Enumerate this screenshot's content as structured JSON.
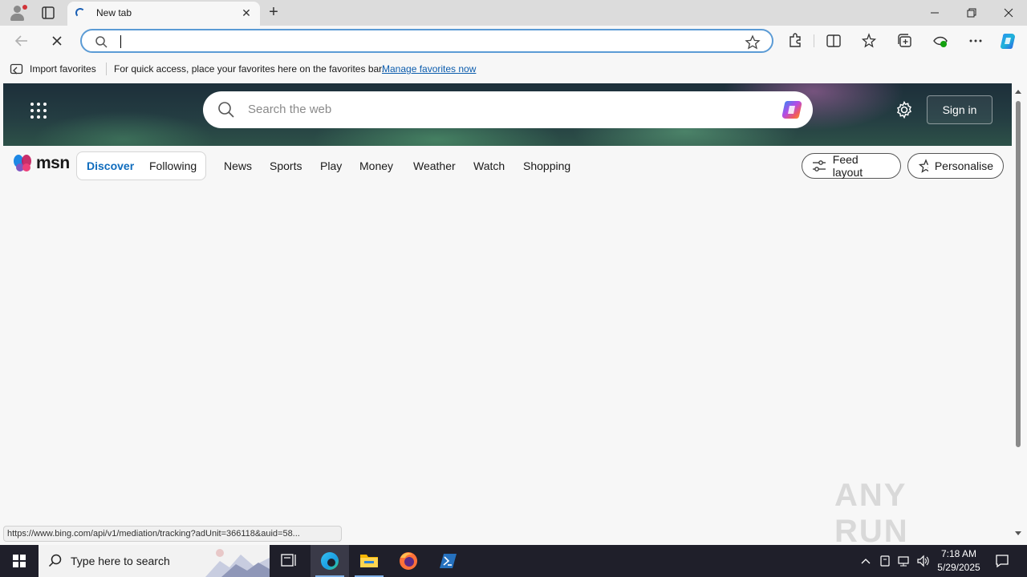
{
  "browser": {
    "tab_title": "New tab",
    "address_value": "",
    "favorites_bar": {
      "import_label": "Import favorites",
      "message": "For quick access, place your favorites here on the favorites bar.",
      "manage_link": "Manage favorites now"
    },
    "status_url": "https://www.bing.com/api/v1/mediation/tracking?adUnit=366118&auid=58..."
  },
  "msn": {
    "search_placeholder": "Search the web",
    "signin_label": "Sign in",
    "logo_text": "msn",
    "tabs": [
      {
        "label": "Discover",
        "selected": true
      },
      {
        "label": "Following",
        "selected": false
      }
    ],
    "nav": [
      "News",
      "Sports",
      "Play",
      "Money",
      "Weather",
      "Watch",
      "Shopping"
    ],
    "feed_layout_label": "Feed layout",
    "personalise_label": "Personalise"
  },
  "watermark": {
    "text": "ANY RUN"
  },
  "taskbar": {
    "search_placeholder": "Type here to search",
    "time": "7:18 AM",
    "date": "5/29/2025"
  },
  "colors": {
    "accent": "#0f6cbd",
    "address_border": "#5b9bd5",
    "taskbar": "#1f1f2a"
  }
}
